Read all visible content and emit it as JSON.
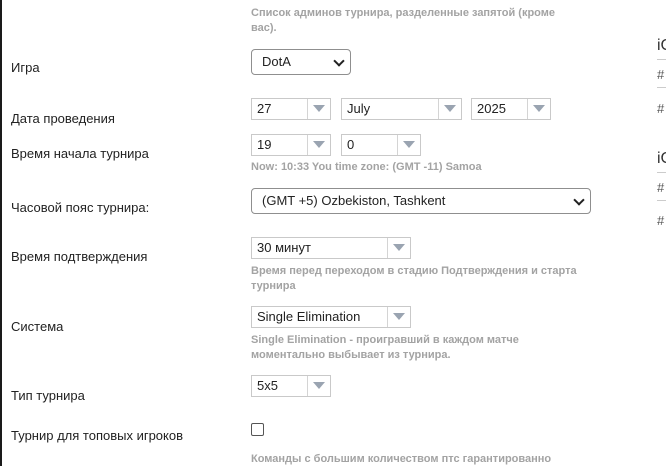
{
  "admins_hint": "Список админов турнира, разделенные запятой (кроме вас).",
  "game": {
    "label": "Игра",
    "value": "DotA"
  },
  "date": {
    "label": "Дата проведения",
    "day": "27",
    "month": "July",
    "year": "2025"
  },
  "start_time": {
    "label": "Время начала турнира",
    "hour": "19",
    "minute": "0",
    "hint": "Now: 10:33 You time zone: (GMT -11) Samoa"
  },
  "timezone": {
    "label": "Часовой пояс турнира:",
    "value": "(GMT +5) Ozbekiston, Tashkent"
  },
  "confirm": {
    "label": "Время подтверждения",
    "value": "30 минут",
    "hint": "Время перед переходом в стадию Подтверждения и старта турнира"
  },
  "system": {
    "label": "Система",
    "value": "Single Elimination",
    "hint": "Single Elimination - проигравший в каждом матче моментально выбывает из турнира."
  },
  "type": {
    "label": "Тип турнира",
    "value": "5x5"
  },
  "top_players": {
    "label": "Турнир для топовых игроков",
    "hint": "Команды с большим количеством птс гарантированно"
  },
  "right_column": {
    "block1_title": "iC",
    "block1_row1": "#",
    "block1_row2": "#",
    "block2_title": "iC",
    "block2_row1": "#",
    "block2_row2": "#"
  }
}
